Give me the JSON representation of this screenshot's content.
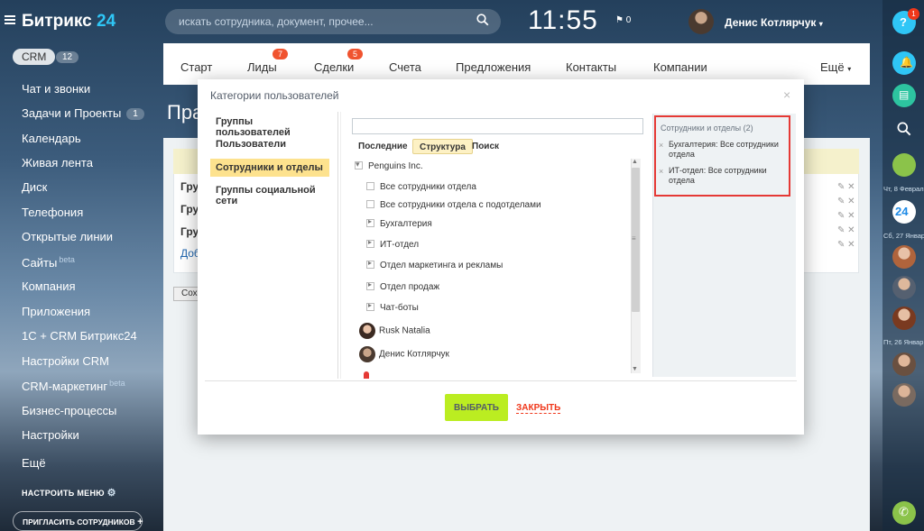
{
  "app": {
    "logo_text": "Битрикс",
    "logo_num": "24"
  },
  "header": {
    "search_placeholder": "искать сотрудника, документ, прочее...",
    "clock": "11:55",
    "flag_count": "0",
    "user_name": "Денис Котлярчук"
  },
  "sidebar": {
    "crm_label": "CRM",
    "crm_count": "12",
    "items": [
      {
        "label": "Чат и звонки"
      },
      {
        "label": "Задачи и Проекты",
        "badge": "1"
      },
      {
        "label": "Календарь"
      },
      {
        "label": "Живая лента"
      },
      {
        "label": "Диск"
      },
      {
        "label": "Телефония"
      },
      {
        "label": "Открытые линии"
      },
      {
        "label": "Сайты",
        "beta": "beta"
      },
      {
        "label": "Компания"
      },
      {
        "label": "Приложения"
      },
      {
        "label": "1С + CRM Битрикс24"
      },
      {
        "label": "Настройки CRM"
      },
      {
        "label": "CRM-маркетинг",
        "beta": "beta"
      },
      {
        "label": "Бизнес-процессы"
      },
      {
        "label": "Настройки"
      },
      {
        "label": "Ещё"
      }
    ],
    "configure_menu": "НАСТРОИТЬ МЕНЮ",
    "invite": "ПРИГЛАСИТЬ СОТРУДНИКОВ"
  },
  "crm_nav": {
    "items": [
      {
        "label": "Старт"
      },
      {
        "label": "Лиды",
        "badge": "7"
      },
      {
        "label": "Сделки",
        "badge": "5"
      },
      {
        "label": "Счета"
      },
      {
        "label": "Предложения"
      },
      {
        "label": "Контакты"
      },
      {
        "label": "Компании"
      }
    ],
    "more": "Ещё"
  },
  "background_page": {
    "title_fragment": "Пра",
    "rows": [
      "Груп",
      "Груп",
      "Груп"
    ],
    "add_link": "Доба",
    "save_btn": "Сохр"
  },
  "right_panel": {
    "help_badge": "1",
    "logo_24": "24",
    "dates": [
      "Чт, 8 Феврал",
      "Сб, 27 Январ",
      "Пт, 26 Январ"
    ]
  },
  "dialog": {
    "title": "Категории пользователей",
    "categories": [
      {
        "label": "Группы пользователей",
        "active": false
      },
      {
        "label": "Пользователи",
        "active": false
      },
      {
        "label": "Сотрудники и отделы",
        "active": true
      },
      {
        "label": "Группы социальной сети",
        "active": false
      }
    ],
    "tabs": [
      {
        "label": "Последние",
        "active": false
      },
      {
        "label": "Структура",
        "active": true
      },
      {
        "label": "Поиск",
        "active": false
      }
    ],
    "tree": {
      "root": "Penguins Inc.",
      "options": [
        "Все сотрудники отдела",
        "Все сотрудники отдела с подотделами"
      ],
      "departments": [
        "Бухгалтерия",
        "ИТ-отдел",
        "Отдел маркетинга и рекламы",
        "Отдел продаж",
        "Чат-боты"
      ],
      "people": [
        "Rusk Natalia",
        "Денис Котлярчук"
      ]
    },
    "selected": {
      "title": "Сотрудники и отделы (2)",
      "items": [
        "Бухгалтерия: Все сотрудники отдела",
        "ИТ-отдел: Все сотрудники отдела"
      ]
    },
    "buttons": {
      "select": "ВЫБРАТЬ",
      "close": "ЗАКРЫТЬ"
    }
  },
  "colors": {
    "accent_blue": "#2fc6f6",
    "select_green": "#bbed21",
    "close_red": "#f0371a",
    "highlight_red": "#e53935",
    "badge_red": "#f0532f"
  }
}
